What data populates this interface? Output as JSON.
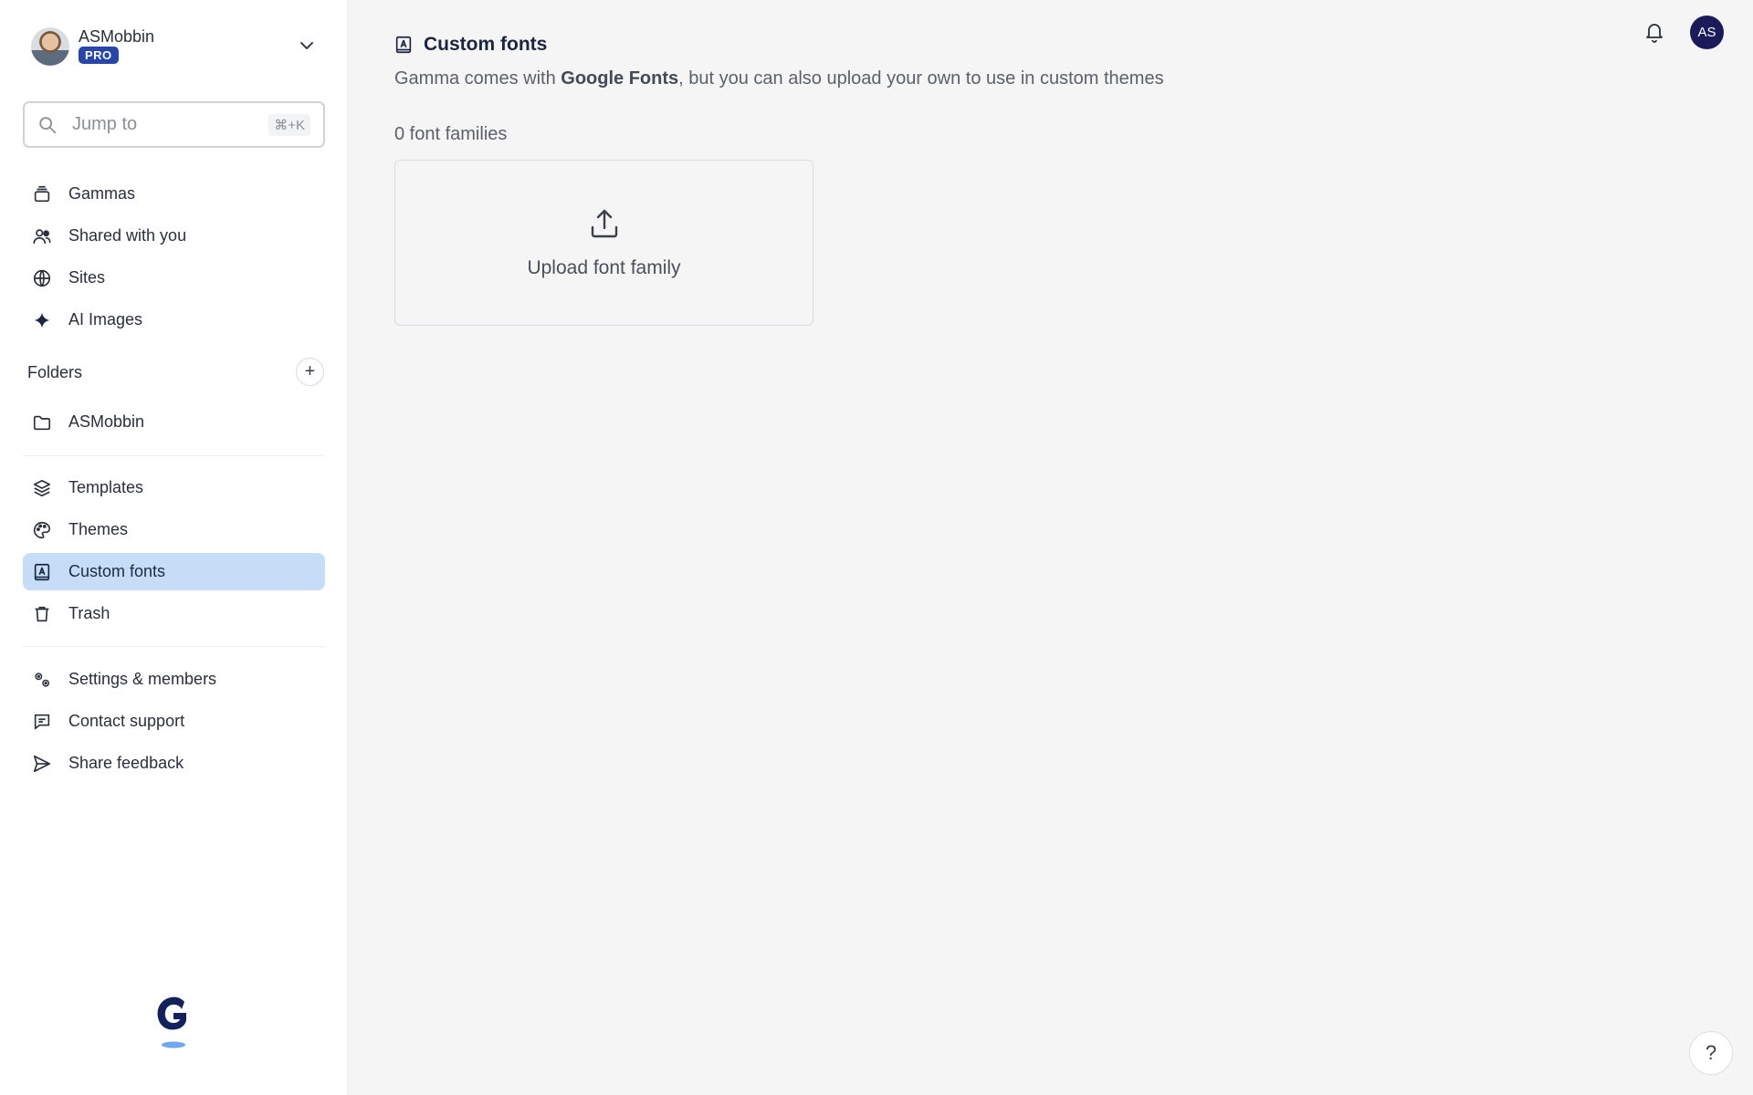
{
  "sidebar": {
    "profile": {
      "name": "ASMobbin",
      "badge": "PRO"
    },
    "search": {
      "placeholder": "Jump to",
      "shortcut": "⌘+K"
    },
    "nav_top": [
      {
        "label": "Gammas",
        "icon": "stack-icon"
      },
      {
        "label": "Shared with you",
        "icon": "users-icon"
      },
      {
        "label": "Sites",
        "icon": "globe-icon"
      },
      {
        "label": "AI Images",
        "icon": "sparkle-icon"
      }
    ],
    "folders": {
      "title": "Folders",
      "items": [
        {
          "label": "ASMobbin",
          "icon": "folder-icon"
        }
      ]
    },
    "nav_mid": [
      {
        "label": "Templates",
        "icon": "layers-icon"
      },
      {
        "label": "Themes",
        "icon": "palette-icon"
      },
      {
        "label": "Custom fonts",
        "icon": "font-book-icon",
        "active": true
      },
      {
        "label": "Trash",
        "icon": "trash-icon"
      }
    ],
    "nav_bottom": [
      {
        "label": "Settings & members",
        "icon": "gears-icon"
      },
      {
        "label": "Contact support",
        "icon": "chat-icon"
      },
      {
        "label": "Share feedback",
        "icon": "send-icon"
      }
    ]
  },
  "main": {
    "title": "Custom fonts",
    "subtitle_pre": "Gamma comes with ",
    "subtitle_bold": "Google Fonts",
    "subtitle_post": ", but you can also upload your own to use in custom themes",
    "count": "0 font families",
    "upload_label": "Upload font family"
  },
  "header": {
    "user_initials": "AS"
  },
  "help_label": "?",
  "colors": {
    "accent_active": "#c6ddf8",
    "badge": "#2746a8",
    "avatar": "#1c1b5a"
  }
}
